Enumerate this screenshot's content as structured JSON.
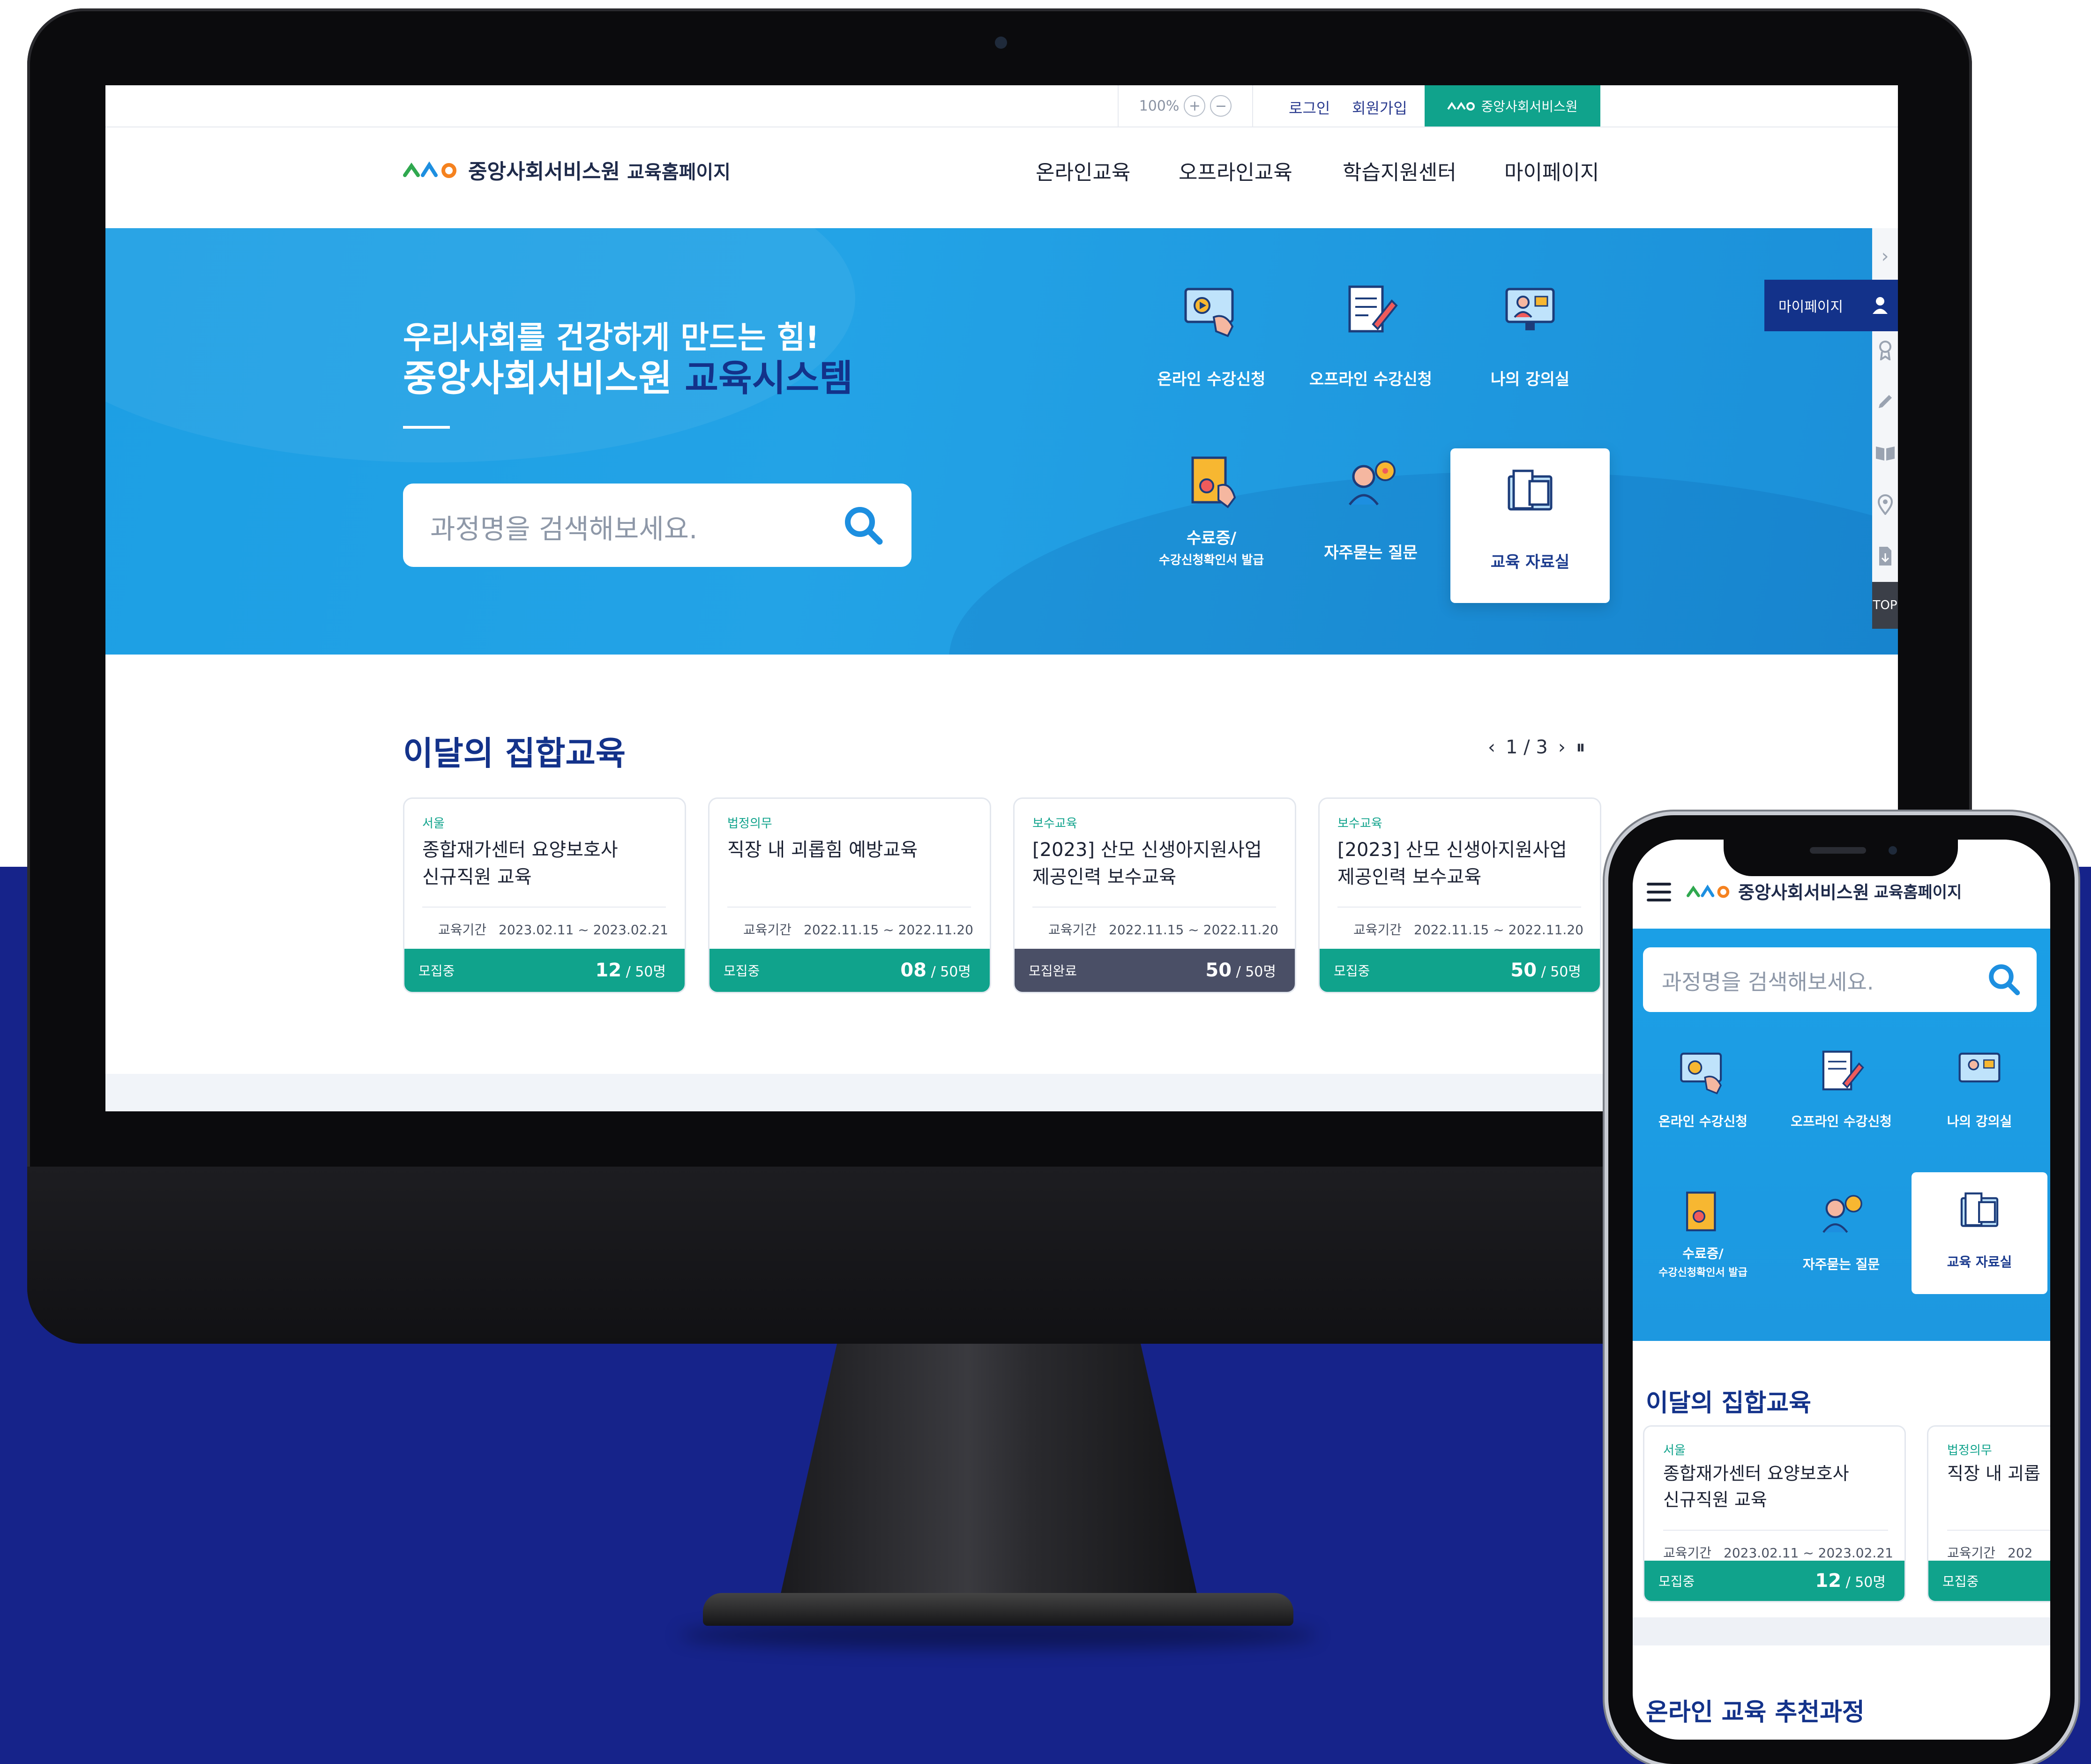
{
  "topbar": {
    "zoom_level": "100%",
    "zoom_in": "+",
    "zoom_out": "−",
    "login": "로그인",
    "signup": "회원가입",
    "brand_tab": "중앙사회서비스원"
  },
  "header": {
    "logo_name": "중앙사회서비스원",
    "logo_sub": "교육홈페이지",
    "nav": [
      "온라인교육",
      "오프라인교육",
      "학습지원센터",
      "마이페이지"
    ]
  },
  "hero": {
    "line1": "우리사회를 건강하게 만드는 힘!",
    "line2_main": "중앙사회서비스원",
    "line2_accent": "교육시스템",
    "search_placeholder": "과정명을 검색해보세요."
  },
  "quick_menu": [
    {
      "label": "온라인 수강신청",
      "icon": "online-apply-icon"
    },
    {
      "label": "오프라인 수강신청",
      "icon": "offline-apply-icon"
    },
    {
      "label": "나의 강의실",
      "icon": "my-classroom-icon"
    },
    {
      "label": "수료증/",
      "sub": "수강신청확인서 발급",
      "icon": "certificate-icon"
    },
    {
      "label": "자주묻는 질문",
      "icon": "faq-icon"
    },
    {
      "label": "교육 자료실",
      "icon": "library-icon"
    }
  ],
  "sidebar": {
    "mypage_label": "마이페이지",
    "top_label": "TOP"
  },
  "monthly": {
    "title": "이달의 집합교육",
    "pager_current": "1",
    "pager_sep": "/",
    "pager_total": "3"
  },
  "cards": [
    {
      "category": "서울",
      "title": "종합재가센터 요양보호사\n신규직원 교육",
      "period_label": "교육기간",
      "period": "2023.02.11 ~ 2023.02.21",
      "status": "모집중",
      "count": "12",
      "capacity": " / 50명"
    },
    {
      "category": "법정의무",
      "title": "직장 내 괴롭힘 예방교육",
      "period_label": "교육기간",
      "period": "2022.11.15 ~ 2022.11.20",
      "status": "모집중",
      "count": "08",
      "capacity": " / 50명"
    },
    {
      "category": "보수교육",
      "title": "[2023] 산모 신생아지원사업\n제공인력 보수교육",
      "period_label": "교육기간",
      "period": "2022.11.15 ~ 2022.11.20",
      "status": "모집완료",
      "count": "50",
      "capacity": " / 50명"
    },
    {
      "category": "보수교육",
      "title": "[2023] 산모 신생아지원사업\n제공인력 보수교육",
      "period_label": "교육기간",
      "period": "2022.11.15 ~ 2022.11.20",
      "status": "모집중",
      "count": "50",
      "capacity": " / 50명"
    }
  ],
  "mobile": {
    "logo_name": "중앙사회서비스원",
    "logo_sub": "교육홈페이지",
    "search_placeholder": "과정명을 검색해보세요.",
    "section_title": "이달의 집합교육",
    "section2_title": "온라인 교육 추천과정",
    "card1": {
      "category": "서울",
      "title": "종합재가센터 요양보호사\n신규직원 교육",
      "period_label": "교육기간",
      "period": "2023.02.11 ~ 2023.02.21",
      "status": "모집중",
      "count": "12",
      "capacity": " / 50명"
    },
    "card2": {
      "category": "법정의무",
      "title": "직장 내 괴롭",
      "period_label": "교육기간",
      "period": "202",
      "status": "모집중"
    }
  },
  "colors": {
    "navy": "#13328a",
    "hero_blue": "#1d9fe4",
    "green": "#10a38c",
    "closed_gray": "#4a4f66",
    "band": "#16238a"
  }
}
